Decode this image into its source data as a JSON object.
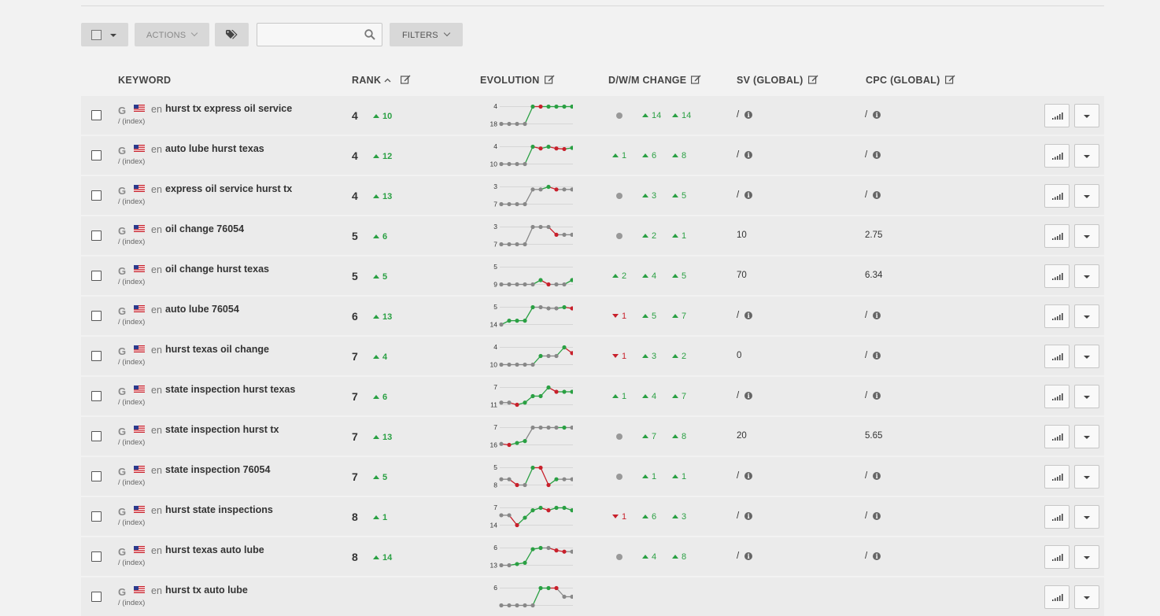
{
  "toolbar": {
    "actions_label": "ACTIONS",
    "filters_label": "FILTERS",
    "search_value": "",
    "search_placeholder": ""
  },
  "columns": {
    "keyword": "KEYWORD",
    "rank": "RANK",
    "evolution": "EVOLUTION",
    "change": "D/W/M CHANGE",
    "sv": "SV (GLOBAL)",
    "cpc": "CPC (GLOBAL)"
  },
  "colors": {
    "up": "#2aa043",
    "down": "#c8202b",
    "neutral": "#888888",
    "line": "#cfcfcf"
  },
  "rows": [
    {
      "engine": "G",
      "lang": "en",
      "keyword": "hurst tx express oil service",
      "path": "/ (index)",
      "rank": "4",
      "rank_change": "10",
      "d": null,
      "w": {
        "dir": "up",
        "v": "14"
      },
      "m": {
        "dir": "up",
        "v": "14"
      },
      "sv": "/",
      "cpc": "/",
      "spark": {
        "top": "4",
        "bottom": "18",
        "points": [
          18,
          18,
          18,
          18,
          4,
          4,
          4,
          4,
          4,
          4,
          4
        ],
        "colors": [
          "g",
          "g",
          "g",
          "g",
          "gr",
          "r",
          "gr",
          "gr",
          "gr",
          "gr",
          "gr"
        ]
      }
    },
    {
      "engine": "G",
      "lang": "en",
      "keyword": "auto lube hurst texas",
      "path": "/ (index)",
      "rank": "4",
      "rank_change": "12",
      "d": {
        "dir": "up",
        "v": "1"
      },
      "w": {
        "dir": "up",
        "v": "6"
      },
      "m": {
        "dir": "up",
        "v": "8"
      },
      "sv": "/",
      "cpc": "/",
      "spark": {
        "top": "4",
        "bottom": "10",
        "points": [
          10,
          10,
          10,
          10,
          4,
          4.6,
          4,
          4.6,
          4.8,
          4.4,
          4
        ],
        "colors": [
          "g",
          "g",
          "g",
          "g",
          "gr",
          "r",
          "gr",
          "r",
          "r",
          "gr",
          "gr"
        ]
      }
    },
    {
      "engine": "G",
      "lang": "en",
      "keyword": "express oil service hurst tx",
      "path": "/ (index)",
      "rank": "4",
      "rank_change": "13",
      "d": null,
      "w": {
        "dir": "up",
        "v": "3"
      },
      "m": {
        "dir": "up",
        "v": "5"
      },
      "sv": "/",
      "cpc": "/",
      "spark": {
        "top": "3",
        "bottom": "7",
        "points": [
          7,
          7,
          7,
          7,
          3.6,
          3.6,
          3,
          3.6,
          3.6,
          3.6,
          3.6
        ],
        "colors": [
          "g",
          "g",
          "g",
          "g",
          "g",
          "g",
          "gr",
          "r",
          "g",
          "g",
          "g"
        ]
      }
    },
    {
      "engine": "G",
      "lang": "en",
      "keyword": "oil change 76054",
      "path": "/ (index)",
      "rank": "5",
      "rank_change": "6",
      "d": null,
      "w": {
        "dir": "up",
        "v": "2"
      },
      "m": {
        "dir": "up",
        "v": "1"
      },
      "sv": "10",
      "cpc": "2.75",
      "spark": {
        "top": "3",
        "bottom": "7",
        "points": [
          7,
          7,
          7,
          7,
          3,
          3,
          3,
          4.8,
          4.8,
          4.8,
          4.8
        ],
        "colors": [
          "g",
          "g",
          "g",
          "g",
          "g",
          "g",
          "g",
          "r",
          "g",
          "g",
          "g"
        ]
      }
    },
    {
      "engine": "G",
      "lang": "en",
      "keyword": "oil change hurst texas",
      "path": "/ (index)",
      "rank": "5",
      "rank_change": "5",
      "d": {
        "dir": "up",
        "v": "2"
      },
      "w": {
        "dir": "up",
        "v": "4"
      },
      "m": {
        "dir": "up",
        "v": "5"
      },
      "sv": "70",
      "cpc": "6.34",
      "spark": {
        "top": "5",
        "bottom": "9",
        "points": [
          9,
          9,
          9,
          9,
          9,
          8,
          9,
          9,
          9,
          8,
          5
        ],
        "colors": [
          "g",
          "g",
          "g",
          "g",
          "g",
          "gr",
          "r",
          "g",
          "g",
          "gr",
          "gr"
        ]
      }
    },
    {
      "engine": "G",
      "lang": "en",
      "keyword": "auto lube 76054",
      "path": "/ (index)",
      "rank": "6",
      "rank_change": "13",
      "d": {
        "dir": "down",
        "v": "1"
      },
      "w": {
        "dir": "up",
        "v": "5"
      },
      "m": {
        "dir": "up",
        "v": "7"
      },
      "sv": "/",
      "cpc": "/",
      "spark": {
        "top": "5",
        "bottom": "14",
        "points": [
          14,
          12,
          12,
          12,
          5,
          5,
          5.6,
          5.6,
          5,
          5.6,
          5.6
        ],
        "colors": [
          "g",
          "gr",
          "gr",
          "gr",
          "gr",
          "g",
          "g",
          "g",
          "gr",
          "r",
          "r"
        ]
      }
    },
    {
      "engine": "G",
      "lang": "en",
      "keyword": "hurst texas oil change",
      "path": "/ (index)",
      "rank": "7",
      "rank_change": "4",
      "d": {
        "dir": "down",
        "v": "1"
      },
      "w": {
        "dir": "up",
        "v": "3"
      },
      "m": {
        "dir": "up",
        "v": "2"
      },
      "sv": "0",
      "cpc": "/",
      "spark": {
        "top": "4",
        "bottom": "10",
        "points": [
          10,
          10,
          10,
          10,
          10,
          7,
          7,
          7,
          4,
          6,
          6.6
        ],
        "colors": [
          "g",
          "g",
          "g",
          "g",
          "g",
          "gr",
          "g",
          "g",
          "gr",
          "r",
          "r"
        ]
      }
    },
    {
      "engine": "G",
      "lang": "en",
      "keyword": "state inspection hurst texas",
      "path": "/ (index)",
      "rank": "7",
      "rank_change": "6",
      "d": {
        "dir": "up",
        "v": "1"
      },
      "w": {
        "dir": "up",
        "v": "4"
      },
      "m": {
        "dir": "up",
        "v": "7"
      },
      "sv": "/",
      "cpc": "/",
      "spark": {
        "top": "7",
        "bottom": "11",
        "points": [
          10.5,
          10.5,
          11,
          10.5,
          9,
          9,
          7,
          8,
          8,
          8,
          7
        ],
        "colors": [
          "g",
          "g",
          "r",
          "gr",
          "gr",
          "gr",
          "gr",
          "r",
          "gr",
          "gr",
          "gr"
        ]
      }
    },
    {
      "engine": "G",
      "lang": "en",
      "keyword": "state inspection hurst tx",
      "path": "/ (index)",
      "rank": "7",
      "rank_change": "13",
      "d": null,
      "w": {
        "dir": "up",
        "v": "7"
      },
      "m": {
        "dir": "up",
        "v": "8"
      },
      "sv": "20",
      "cpc": "5.65",
      "spark": {
        "top": "7",
        "bottom": "16",
        "points": [
          15.5,
          16,
          15,
          14,
          7,
          7,
          7,
          7,
          7,
          7,
          7
        ],
        "colors": [
          "g",
          "r",
          "gr",
          "gr",
          "g",
          "g",
          "g",
          "g",
          "gr",
          "g",
          "g"
        ]
      }
    },
    {
      "engine": "G",
      "lang": "en",
      "keyword": "state inspection 76054",
      "path": "/ (index)",
      "rank": "7",
      "rank_change": "5",
      "d": null,
      "w": {
        "dir": "up",
        "v": "1"
      },
      "m": {
        "dir": "up",
        "v": "1"
      },
      "sv": "/",
      "cpc": "/",
      "spark": {
        "top": "5",
        "bottom": "8",
        "points": [
          7,
          7,
          8,
          8,
          5,
          5,
          8,
          7,
          7,
          7,
          7
        ],
        "colors": [
          "g",
          "g",
          "r",
          "g",
          "gr",
          "r",
          "r",
          "gr",
          "g",
          "g",
          "g"
        ]
      }
    },
    {
      "engine": "G",
      "lang": "en",
      "keyword": "hurst state inspections",
      "path": "/ (index)",
      "rank": "8",
      "rank_change": "1",
      "d": {
        "dir": "down",
        "v": "1"
      },
      "w": {
        "dir": "up",
        "v": "6"
      },
      "m": {
        "dir": "up",
        "v": "3"
      },
      "sv": "/",
      "cpc": "/",
      "spark": {
        "top": "7",
        "bottom": "14",
        "points": [
          10,
          10,
          14,
          11,
          8,
          7,
          8,
          7,
          7,
          8,
          8
        ],
        "colors": [
          "g",
          "g",
          "r",
          "gr",
          "gr",
          "gr",
          "r",
          "gr",
          "gr",
          "gr",
          "r"
        ]
      }
    },
    {
      "engine": "G",
      "lang": "en",
      "keyword": "hurst texas auto lube",
      "path": "/ (index)",
      "rank": "8",
      "rank_change": "14",
      "d": null,
      "w": {
        "dir": "up",
        "v": "4"
      },
      "m": {
        "dir": "up",
        "v": "8"
      },
      "sv": "/",
      "cpc": "/",
      "spark": {
        "top": "6",
        "bottom": "13",
        "points": [
          13,
          13,
          12.5,
          12,
          6.5,
          6,
          6,
          7,
          7.5,
          7.5,
          7.5
        ],
        "colors": [
          "g",
          "g",
          "gr",
          "gr",
          "gr",
          "gr",
          "g",
          "r",
          "r",
          "g",
          "g"
        ]
      }
    },
    {
      "engine": "G",
      "lang": "en",
      "keyword": "hurst tx auto lube",
      "path": "/ (index)",
      "rank": "",
      "rank_change": "",
      "d": null,
      "w": null,
      "m": null,
      "sv": "",
      "cpc": "",
      "spark": {
        "top": "6",
        "bottom": "",
        "points": [
          8,
          8,
          8,
          8,
          8,
          6,
          6,
          6,
          7,
          7,
          7
        ],
        "colors": [
          "g",
          "g",
          "g",
          "g",
          "g",
          "gr",
          "gr",
          "r",
          "g",
          "g",
          "g"
        ]
      }
    }
  ]
}
